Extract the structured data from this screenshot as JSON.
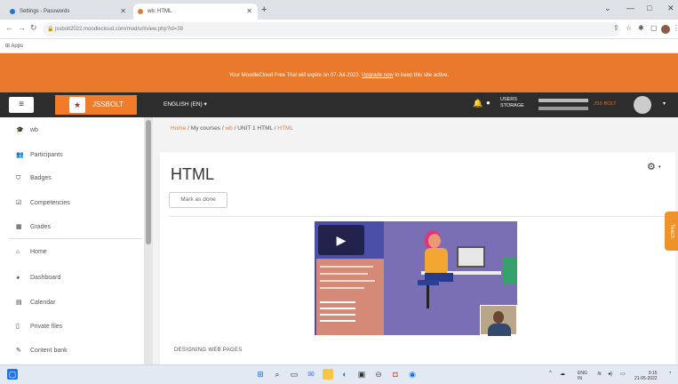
{
  "browser": {
    "tabs": [
      {
        "title": "Settings - Passwords"
      },
      {
        "title": "wb: HTML"
      }
    ],
    "url": "jssbolt2022.moodlecloud.com/mod/url/view.php?id=38",
    "bookmarks_label": "Apps"
  },
  "banner": {
    "text_before": "Your MoodleCloud Free Trial will expire on 07-Jul-2022.",
    "link_text": "Upgrade now",
    "text_after": "to keep this site active."
  },
  "navbar": {
    "site_name": "JSSBOLT",
    "language": "ENGLISH (EN) ▾",
    "users_label": "USERS",
    "storage_label": "STORAGE",
    "user_name": "JSS BOLT"
  },
  "sidebar": {
    "items": [
      {
        "label": "wb",
        "icon": "graduation-cap-icon"
      },
      {
        "label": "Participants",
        "icon": "users-icon"
      },
      {
        "label": "Badges",
        "icon": "shield-icon"
      },
      {
        "label": "Competencies",
        "icon": "checkbox-icon"
      },
      {
        "label": "Grades",
        "icon": "table-icon"
      },
      {
        "label": "Home",
        "icon": "home-icon"
      },
      {
        "label": "Dashboard",
        "icon": "dashboard-icon"
      },
      {
        "label": "Calendar",
        "icon": "calendar-icon"
      },
      {
        "label": "Private files",
        "icon": "file-icon"
      },
      {
        "label": "Content bank",
        "icon": "pencil-icon"
      }
    ]
  },
  "breadcrumb": {
    "home": "Home",
    "sep": "/",
    "courses": "My courses",
    "course": "wb",
    "unit": "UNIT 1 HTML",
    "page": "HTML"
  },
  "main": {
    "title": "HTML",
    "mark_done": "Mark as done",
    "caption": "DESIGNING WEB PAGES"
  },
  "side_tab": "Teach",
  "taskbar": {
    "lang": "ENG",
    "lang2": "IN",
    "time": "9:15",
    "date": "21-05-2022"
  },
  "colors": {
    "accent": "#e8792b",
    "navbar": "#2d2d2d"
  }
}
